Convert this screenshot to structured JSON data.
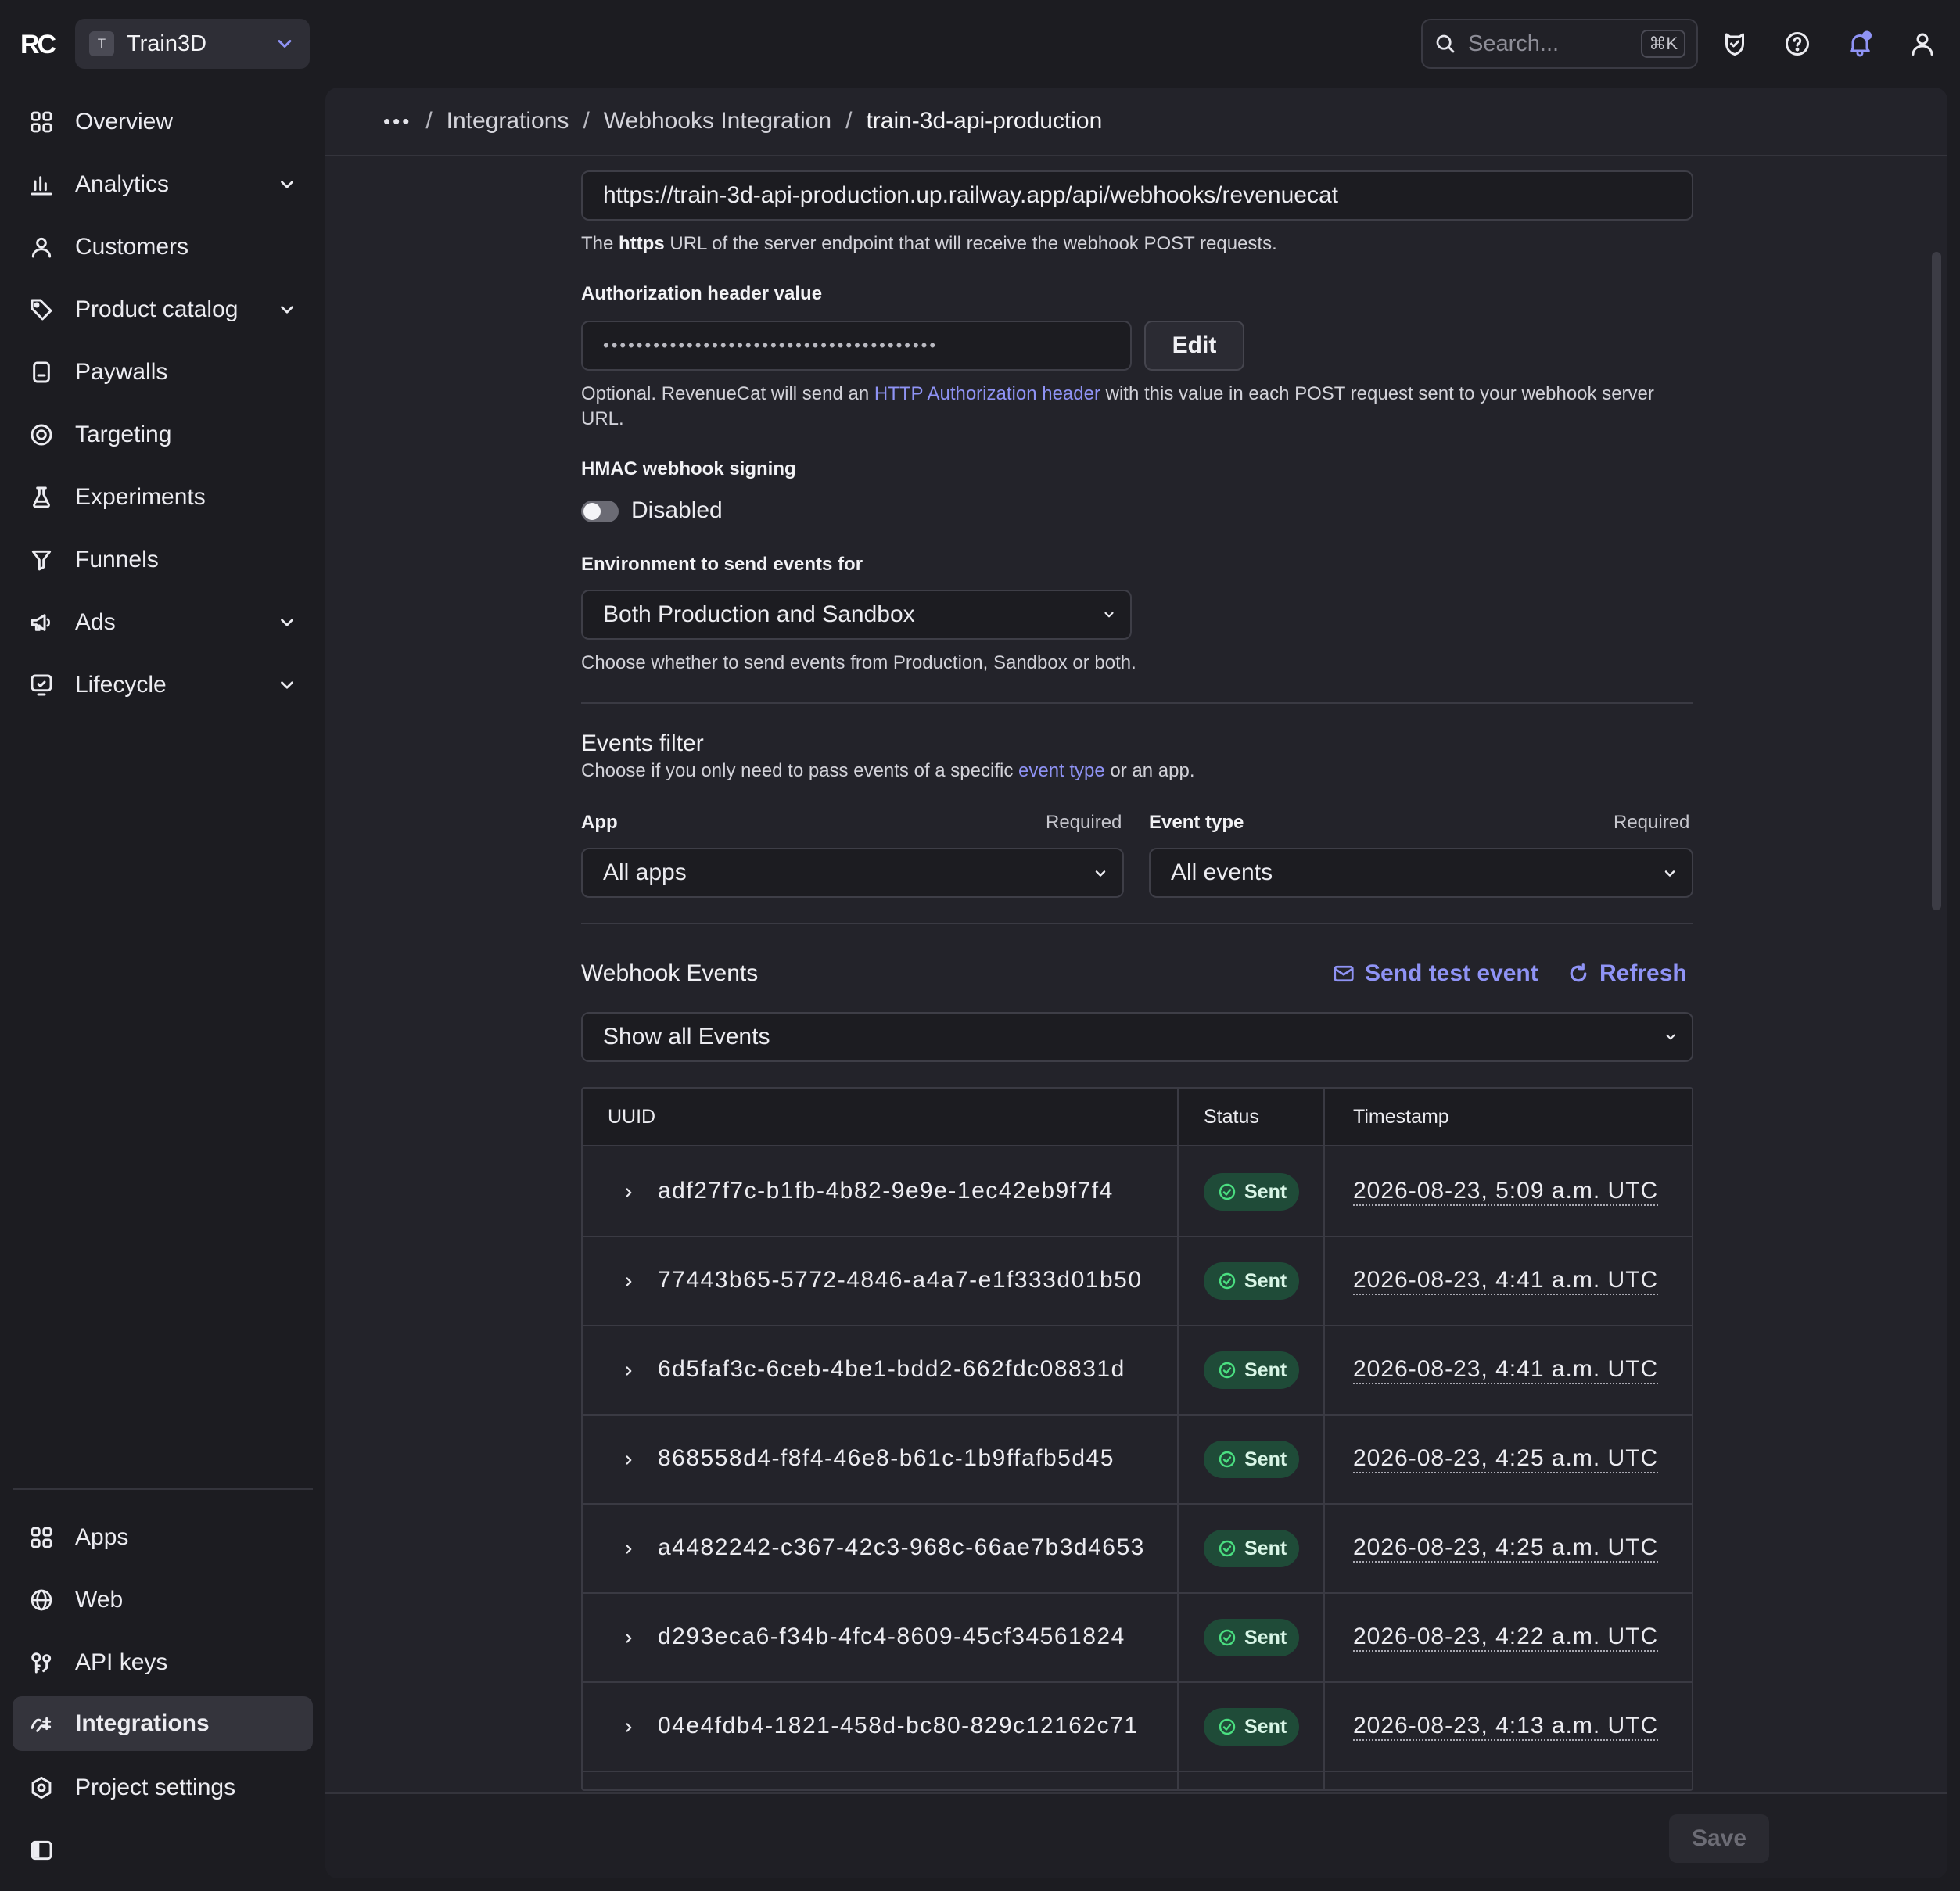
{
  "logo": {
    "text": "RC"
  },
  "project": {
    "badge": "T",
    "name": "Train3D"
  },
  "search": {
    "placeholder": "Search...",
    "shortcut": "⌘K"
  },
  "sidebar": {
    "items": [
      {
        "label": "Overview"
      },
      {
        "label": "Analytics"
      },
      {
        "label": "Customers"
      },
      {
        "label": "Product catalog"
      },
      {
        "label": "Paywalls"
      },
      {
        "label": "Targeting"
      },
      {
        "label": "Experiments"
      },
      {
        "label": "Funnels"
      },
      {
        "label": "Ads"
      },
      {
        "label": "Lifecycle"
      }
    ],
    "bottom": [
      {
        "label": "Apps"
      },
      {
        "label": "Web"
      },
      {
        "label": "API keys"
      },
      {
        "label": "Integrations"
      },
      {
        "label": "Project settings"
      }
    ]
  },
  "breadcrumb": {
    "ellipsis": "•••",
    "sep": "/",
    "items": [
      "Integrations",
      "Webhooks Integration",
      "train-3d-api-production"
    ]
  },
  "form": {
    "url_value": "https://train-3d-api-production.up.railway.app/api/webhooks/revenuecat",
    "url_help_pre": "The ",
    "url_help_bold": "https",
    "url_help_post": " URL of the server endpoint that will receive the webhook POST requests.",
    "auth_label": "Authorization header value",
    "auth_value": "••••••••••••••••••••••••••••••••••••••••",
    "edit_label": "Edit",
    "auth_help_pre": "Optional. RevenueCat will send an ",
    "auth_help_link": "HTTP Authorization header",
    "auth_help_post": " with this value in each POST request sent to your webhook server URL.",
    "hmac_label": "HMAC webhook signing",
    "hmac_state": "Disabled",
    "env_label": "Environment to send events for",
    "env_value": "Both Production and Sandbox",
    "env_help": "Choose whether to send events from Production, Sandbox or both."
  },
  "filter": {
    "title": "Events filter",
    "help_pre": "Choose if you only need to pass events of a specific ",
    "help_link": "event type",
    "help_post": " or an app.",
    "app_label": "App",
    "app_required": "Required",
    "app_value": "All apps",
    "event_label": "Event type",
    "event_required": "Required",
    "event_value": "All events"
  },
  "events": {
    "title": "Webhook Events",
    "send_test": "Send test event",
    "refresh": "Refresh",
    "show_value": "Show all Events",
    "columns": [
      "UUID",
      "Status",
      "Timestamp"
    ],
    "rows": [
      {
        "uuid": "adf27f7c-b1fb-4b82-9e9e-1ec42eb9f7f4",
        "status": "Sent",
        "timestamp": "2026-08-23, 5:09 a.m. UTC"
      },
      {
        "uuid": "77443b65-5772-4846-a4a7-e1f333d01b50",
        "status": "Sent",
        "timestamp": "2026-08-23, 4:41 a.m. UTC"
      },
      {
        "uuid": "6d5faf3c-6ceb-4be1-bdd2-662fdc08831d",
        "status": "Sent",
        "timestamp": "2026-08-23, 4:41 a.m. UTC"
      },
      {
        "uuid": "868558d4-f8f4-46e8-b61c-1b9ffafb5d45",
        "status": "Sent",
        "timestamp": "2026-08-23, 4:25 a.m. UTC"
      },
      {
        "uuid": "a4482242-c367-42c3-968c-66ae7b3d4653",
        "status": "Sent",
        "timestamp": "2026-08-23, 4:25 a.m. UTC"
      },
      {
        "uuid": "d293eca6-f34b-4fc4-8609-45cf34561824",
        "status": "Sent",
        "timestamp": "2026-08-23, 4:22 a.m. UTC"
      },
      {
        "uuid": "04e4fdb4-1821-458d-bc80-829c12162c71",
        "status": "Sent",
        "timestamp": "2026-08-23, 4:13 a.m. UTC"
      }
    ]
  },
  "footer": {
    "save": "Save"
  },
  "colors": {
    "accent": "#8f93f5",
    "background": "#1c1c21",
    "panel": "#23232a",
    "sent_badge": "#1f4b38",
    "sent_check": "#4ade80",
    "notification": "#8f93f5"
  },
  "icons": {
    "topbar": [
      "shield-cat-icon",
      "help-circle-icon",
      "bell-icon",
      "user-icon"
    ],
    "sidebar": [
      "grid-icon",
      "bar-chart-icon",
      "user-icon",
      "tag-icon",
      "paywall-icon",
      "target-icon",
      "flask-icon",
      "funnel-icon",
      "megaphone-icon",
      "lifecycle-icon",
      "apps-grid-icon",
      "globe-icon",
      "key-icon",
      "integrations-icon",
      "settings-icon",
      "sidebar-toggle-icon"
    ]
  }
}
